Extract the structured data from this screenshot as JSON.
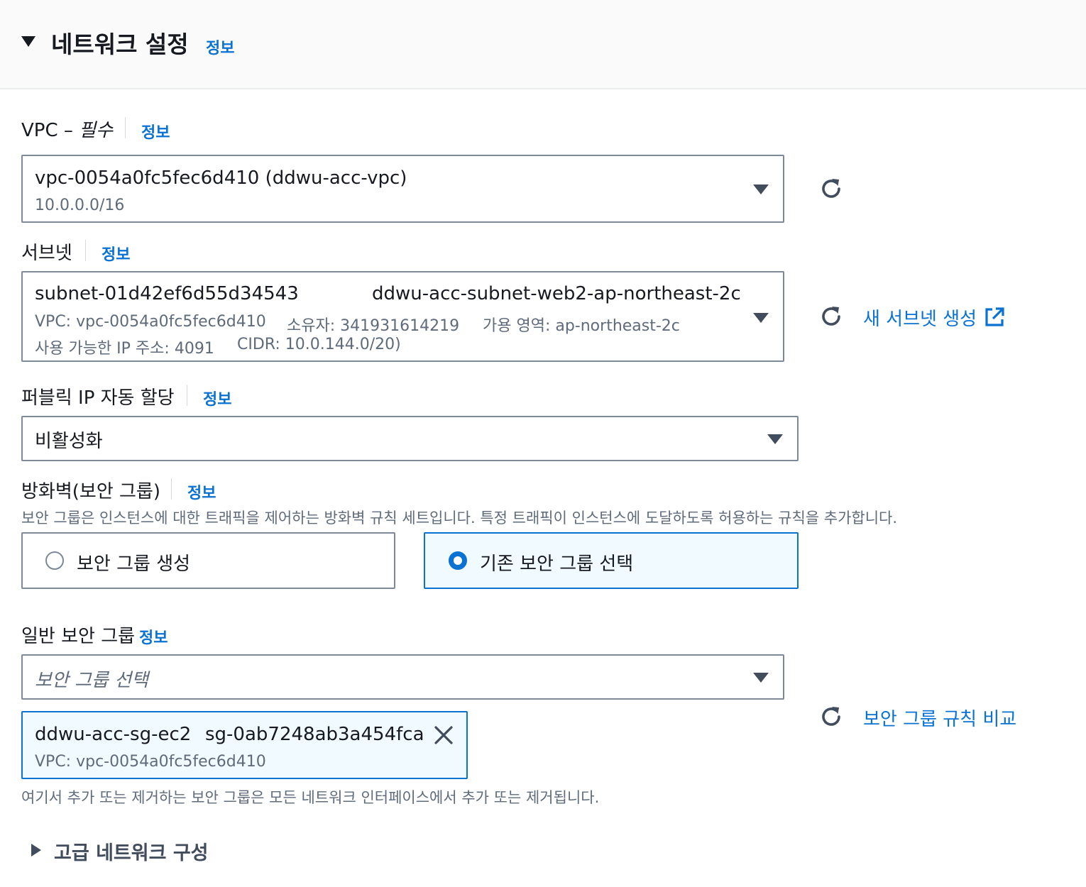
{
  "section": {
    "title": "네트워크 설정",
    "info": "정보"
  },
  "vpc": {
    "label": "VPC – ",
    "required": "필수",
    "info": "정보",
    "selected_name": "vpc-0054a0fc5fec6d410 (ddwu-acc-vpc)",
    "selected_cidr": "10.0.0.0/16"
  },
  "subnet": {
    "label": "서브넷",
    "info": "정보",
    "selected_id": "subnet-01d42ef6d55d34543",
    "selected_name": "ddwu-acc-subnet-web2-ap-northeast-2c",
    "detail_vpc": "VPC: vpc-0054a0fc5fec6d410",
    "detail_owner": "소유자: 341931614219",
    "detail_az": "가용 영역: ap-northeast-2c",
    "detail_ip": "사용 가능한 IP 주소: 4091",
    "detail_cidr": "CIDR: 10.0.144.0/20)",
    "create_link": "새 서브넷 생성"
  },
  "public_ip": {
    "label": "퍼블릭 IP 자동 할당",
    "info": "정보",
    "value": "비활성화"
  },
  "firewall": {
    "label": "방화벽(보안 그룹)",
    "info": "정보",
    "description": "보안 그룹은 인스턴스에 대한 트래픽을 제어하는 방화벽 규칙 세트입니다. 특정 트래픽이 인스턴스에 도달하도록 허용하는 규칙을 추가합니다.",
    "option_create": "보안 그룹 생성",
    "option_existing": "기존 보안 그룹 선택",
    "selected_option": "기존 보안 그룹 선택"
  },
  "security_groups": {
    "label": "일반 보안 그룹",
    "info": "정보",
    "placeholder": "보안 그룹 선택",
    "token_name": "ddwu-acc-sg-ec2",
    "token_id": "sg-0ab7248ab3a454fca",
    "token_vpc": "VPC: vpc-0054a0fc5fec6d410",
    "compare_link": "보안 그룹 규칙 비교",
    "footer": "여기서 추가 또는 제거하는 보안 그룹은 모든 네트워크 인터페이스에서 추가 또는 제거됩니다."
  },
  "advanced": {
    "title": "고급 네트워크 구성"
  },
  "icons": {
    "collapse": "caret-down-icon",
    "expand": "caret-right-icon",
    "refresh": "refresh-icon",
    "external": "external-link-icon",
    "remove": "close-icon"
  },
  "colors": {
    "link": "#0972d3",
    "text": "#16191f",
    "muted": "#5f6b7a",
    "border": "#7d8998",
    "selected_bg": "#f1faff"
  }
}
